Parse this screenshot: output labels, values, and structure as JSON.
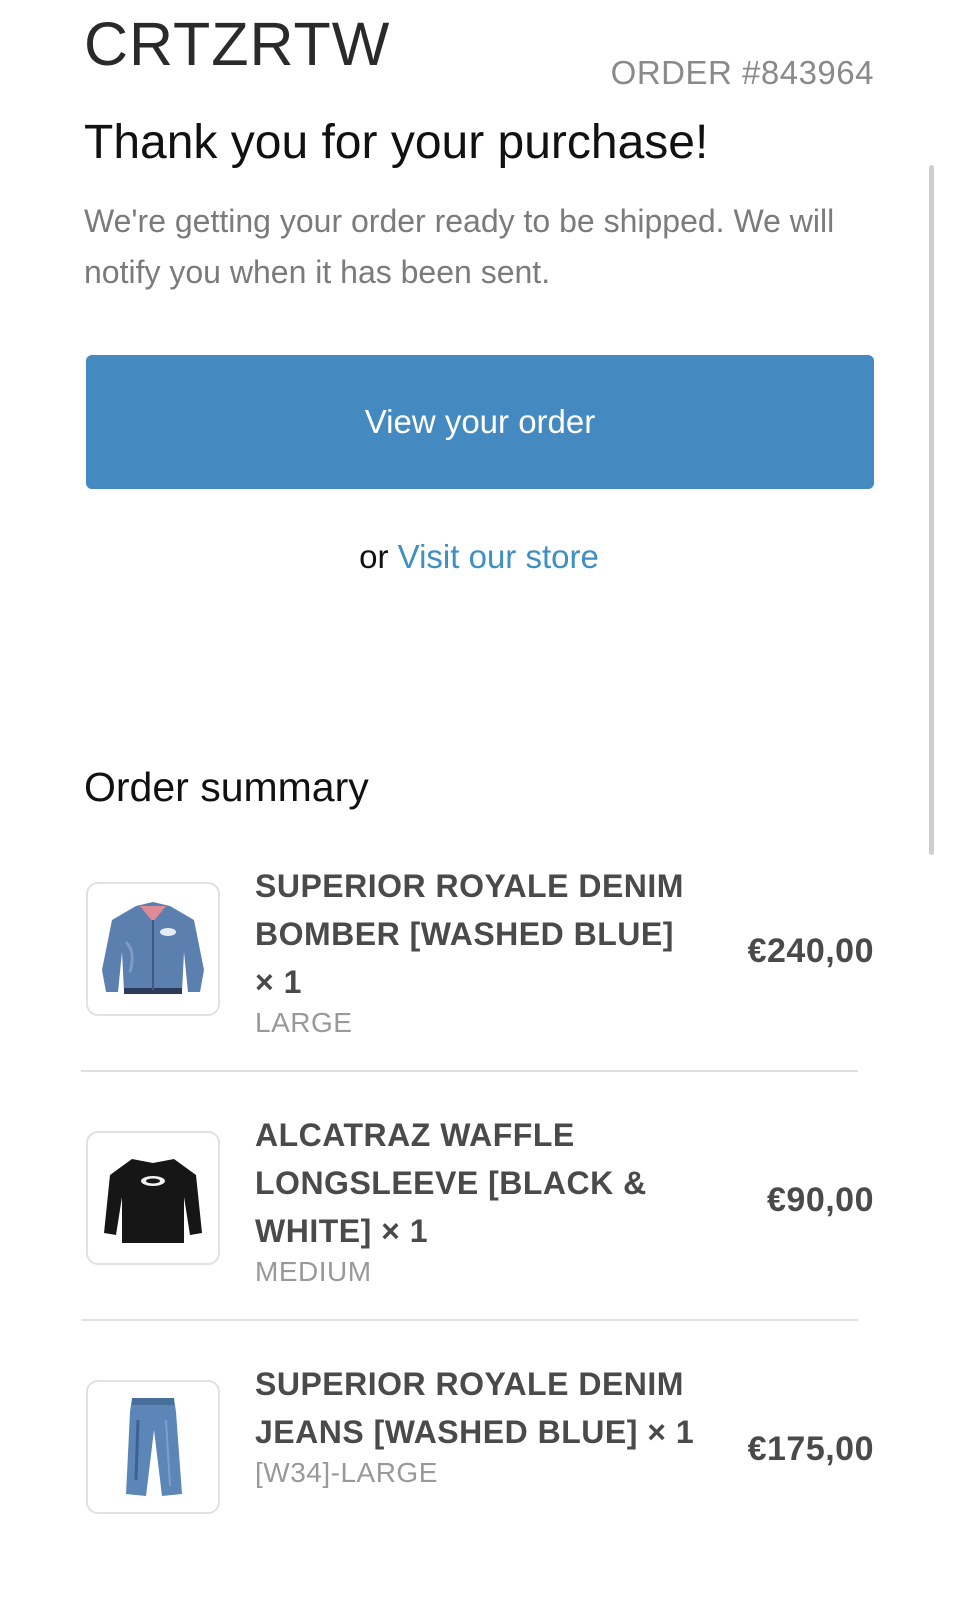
{
  "header": {
    "brand": "CRTZRTW",
    "order_number": "ORDER #843964"
  },
  "confirmation": {
    "title": "Thank you for your purchase!",
    "message": "We're getting your order ready to be shipped. We will notify you when it has been sent.",
    "view_order_label": "View your order",
    "or_text": "or ",
    "store_link_label": "Visit our store"
  },
  "summary": {
    "title": "Order summary",
    "items": [
      {
        "name": "SUPERIOR ROYALE DENIM BOMBER [WASHED BLUE] × 1",
        "variant": "LARGE",
        "price": "€240,00",
        "icon": "denim-bomber-jacket-icon"
      },
      {
        "name": "ALCATRAZ WAFFLE LONGSLEEVE [BLACK & WHITE] × 1",
        "variant": "MEDIUM",
        "price": "€90,00",
        "icon": "black-longsleeve-icon"
      },
      {
        "name": "SUPERIOR ROYALE DENIM JEANS [WASHED BLUE] × 1",
        "variant": "[W34]-LARGE",
        "price": "€175,00",
        "icon": "denim-jeans-icon"
      }
    ]
  },
  "colors": {
    "button": "#448ac1",
    "link": "#3f8fc2",
    "muted_text": "#7b7b7b"
  }
}
